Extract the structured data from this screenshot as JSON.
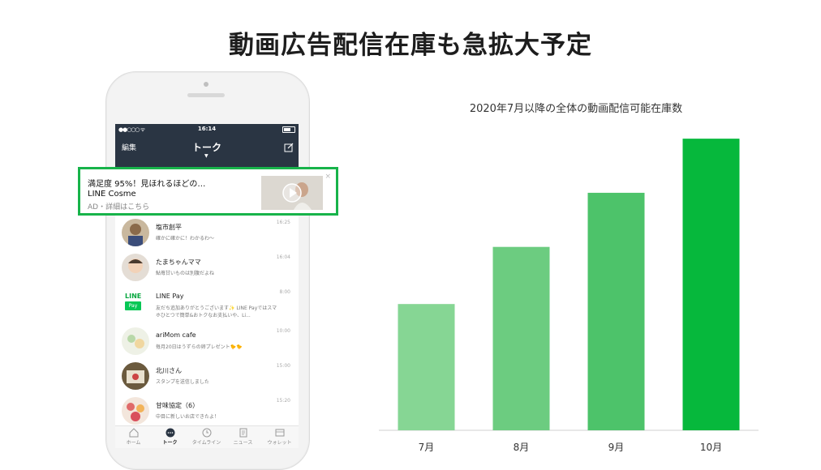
{
  "page": {
    "title": "動画広告配信在庫も急拡大予定"
  },
  "phone": {
    "status_time": "16:14",
    "nav_edit": "編集",
    "nav_title": "トーク",
    "chats": [
      {
        "name": "塩市創平",
        "message": "確かに確かに！わかるわ〜",
        "time": "16:25"
      },
      {
        "name": "たまちゃんママ",
        "message": "鮎苺甘いものは別腹だよね",
        "time": "16:04"
      },
      {
        "name": "LINE Pay",
        "message": "友だち追加ありがとうございます✨ LINE Payではスマホひとつで簡単&おトクなお支払いや、Li...",
        "time": "8:00"
      },
      {
        "name": "ariMom cafe",
        "message": "毎月20日はうずらの卵プレゼント🐤🐤",
        "time": "10:00"
      },
      {
        "name": "北川さん",
        "message": "スタンプを送信しました",
        "time": "15:00"
      },
      {
        "name": "甘味協定（6）",
        "message": "中目に新しいお店できたよ！",
        "time": "15:20"
      }
    ],
    "pay_logo_line": "LINE",
    "pay_logo_pay": "Pay",
    "tabs": [
      "ホーム",
      "トーク",
      "タイムライン",
      "ニュース",
      "ウォレット"
    ]
  },
  "ad": {
    "headline": "満足度 95%！見ほれるほどの…",
    "brand": "LINE Cosme",
    "meta": "AD・詳細はこちら",
    "close": "×"
  },
  "chart_data": {
    "type": "bar",
    "title": "2020年7月以降の全体の動画配信可能在庫数",
    "categories": [
      "7月",
      "8月",
      "9月",
      "10月"
    ],
    "values": [
      42,
      61,
      79,
      97
    ],
    "ylim": [
      0,
      100
    ],
    "grid": false,
    "colors": [
      "#86d694",
      "#6ccc80",
      "#4dc36a",
      "#06b83c"
    ]
  }
}
